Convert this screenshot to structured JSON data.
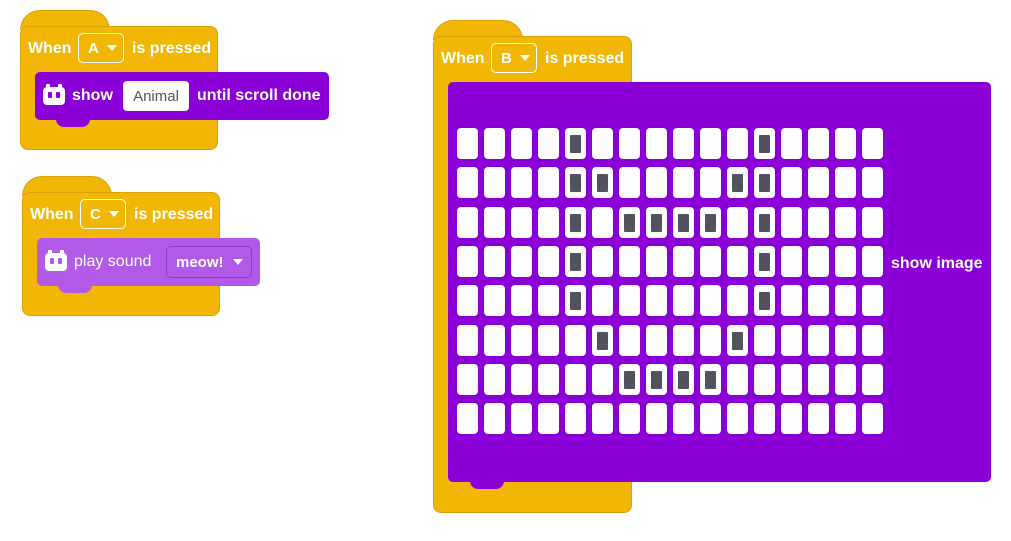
{
  "script_a": {
    "when_label": "When",
    "button": "A",
    "pressed_label": "is pressed",
    "show_label": "show",
    "text_value": "Animal",
    "until_label": "until scroll done"
  },
  "script_c": {
    "when_label": "When",
    "button": "C",
    "pressed_label": "is pressed",
    "play_label": "play sound",
    "sound": "meow!"
  },
  "script_b": {
    "when_label": "When",
    "button": "B",
    "pressed_label": "is pressed",
    "show_image_label": "show image",
    "led_grid": [
      "0000100000010000",
      "0000110000110000",
      "0000101111010000",
      "0000100000010000",
      "0000100000010000",
      "0000010000100000",
      "0000001111000000",
      "0000000000000000"
    ]
  },
  "colors": {
    "hat_block": "#f2b705",
    "display_block": "#8b00d6",
    "sound_block": "#b25ae8",
    "led_off": "#ffffff",
    "led_on": "#53535f"
  }
}
